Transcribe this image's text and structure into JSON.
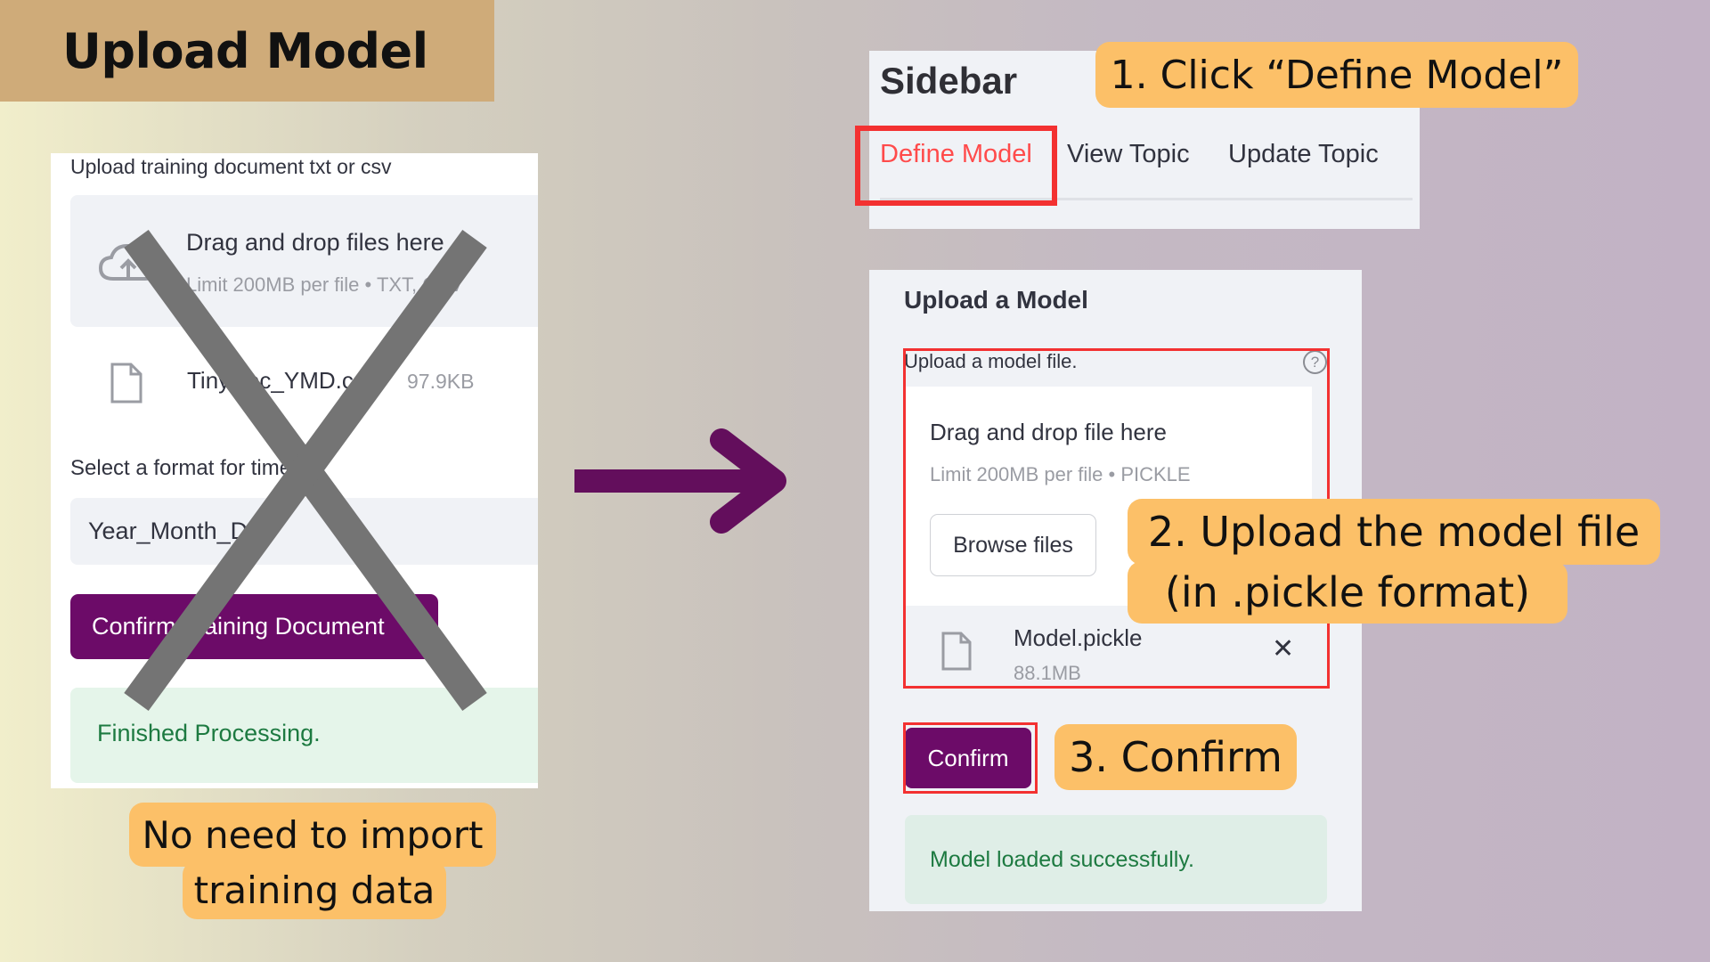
{
  "title": "Upload Model",
  "old_flow": {
    "upload_label": "Upload training document txt or csv",
    "drag_title": "Drag and drop files here",
    "drag_limit": "Limit 200MB per file • TXT, CSV",
    "file_name": "TinyDoc_YMD.csv",
    "file_size": "97.9KB",
    "format_label": "Select a format for time",
    "format_value": "Year_Month_Day",
    "confirm_label": "Confirm Training Document",
    "success_text": "Finished Processing.",
    "note_line1": "No need to import",
    "note_line2": "training data"
  },
  "sidebar": {
    "title": "Sidebar",
    "tabs": [
      {
        "label": "Define Model",
        "active": true
      },
      {
        "label": "View Topic",
        "active": false
      },
      {
        "label": "Update Topic",
        "active": false
      }
    ],
    "step1": "1. Click “Define Model”"
  },
  "upload_model": {
    "title": "Upload a Model",
    "file_label": "Upload a model file.",
    "help_icon": "?",
    "drag_title": "Drag and drop file here",
    "drag_limit": "Limit 200MB per file • PICKLE",
    "browse_label": "Browse files",
    "file_name": "Model.pickle",
    "file_size": "88.1MB",
    "close_glyph": "✕",
    "confirm_label": "Confirm",
    "success_text": "Model loaded successfully.",
    "step2_line1": "2. Upload the model file",
    "step2_line2": "(in .pickle format)",
    "step3": "3. Confirm"
  },
  "colors": {
    "banner": "#cfab79",
    "callout": "#fcc068",
    "primary_button": "#6c0b68",
    "highlight_box": "#f33131",
    "active_tab": "#ff4b4b",
    "arrow": "#630e5c"
  }
}
